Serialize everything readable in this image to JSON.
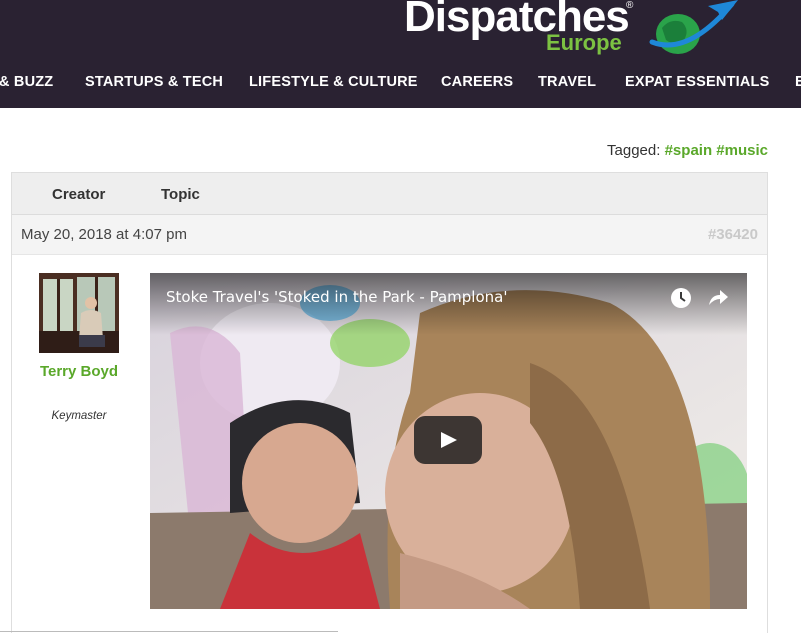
{
  "header": {
    "logo": {
      "main": "Dispatches",
      "reg": "®",
      "sub": "Europe"
    },
    "nav": [
      {
        "label": "& BUZZ"
      },
      {
        "label": "STARTUPS & TECH"
      },
      {
        "label": "LIFESTYLE & CULTURE"
      },
      {
        "label": "CAREERS"
      },
      {
        "label": "TRAVEL"
      },
      {
        "label": "EXPAT ESSENTIALS"
      },
      {
        "label": "E"
      }
    ]
  },
  "tags": {
    "label": "Tagged:",
    "items": [
      "#spain",
      "#music"
    ]
  },
  "forum": {
    "columns": {
      "creator": "Creator",
      "topic": "Topic"
    },
    "post": {
      "date": "May 20, 2018 at 4:07 pm",
      "id": "#36420",
      "author": {
        "name": "Terry Boyd",
        "role": "Keymaster"
      },
      "video": {
        "title": "Stoke Travel's 'Stoked in the Park - Pamplona'",
        "icons": [
          "clock-icon",
          "share-icon",
          "play-icon"
        ]
      }
    }
  },
  "colors": {
    "header_bg": "#2a2232",
    "accent_green": "#5aa82a",
    "logo_blue": "#1e88d8"
  }
}
